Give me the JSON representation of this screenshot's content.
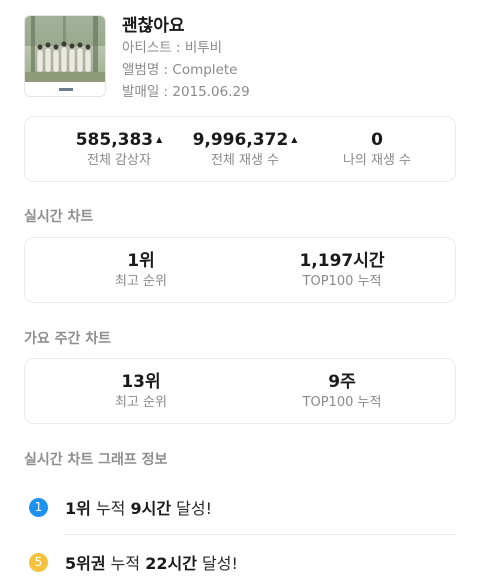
{
  "song": {
    "title": "괜찮아요",
    "artist_label": "아티스트 : ",
    "artist": "비투비",
    "album_label": "앨범명 : ",
    "album": "Complete",
    "release_label": "발매일 : ",
    "release_date": "2015.06.29"
  },
  "stats": {
    "listeners_value": "585,383",
    "listeners_label": "전체 감상자",
    "plays_value": "9,996,372",
    "plays_label": "전체 재생 수",
    "my_plays_value": "0",
    "my_plays_label": "나의 재생 수",
    "trend_icon": "triangle-up"
  },
  "realtime_chart": {
    "title": "실시간 차트",
    "best_rank_value": "1위",
    "best_rank_label": "최고 순위",
    "top100_value": "1,197시간",
    "top100_label": "TOP100 누적"
  },
  "weekly_chart": {
    "title": "가요 주간 차트",
    "best_rank_value": "13위",
    "best_rank_label": "최고 순위",
    "top100_value": "9주",
    "top100_label": "TOP100 누적"
  },
  "graph_info": {
    "title": "실시간 차트 그래프 정보",
    "items": [
      {
        "badge": "1",
        "badge_color": "#1e90f0",
        "rank": "1위",
        "mid": " 누적 ",
        "duration": "9시간",
        "suffix": " 달성!"
      },
      {
        "badge": "5",
        "badge_color": "#f5c23c",
        "rank": "5위권",
        "mid": " 누적 ",
        "duration": "22시간",
        "suffix": " 달성!"
      }
    ]
  }
}
